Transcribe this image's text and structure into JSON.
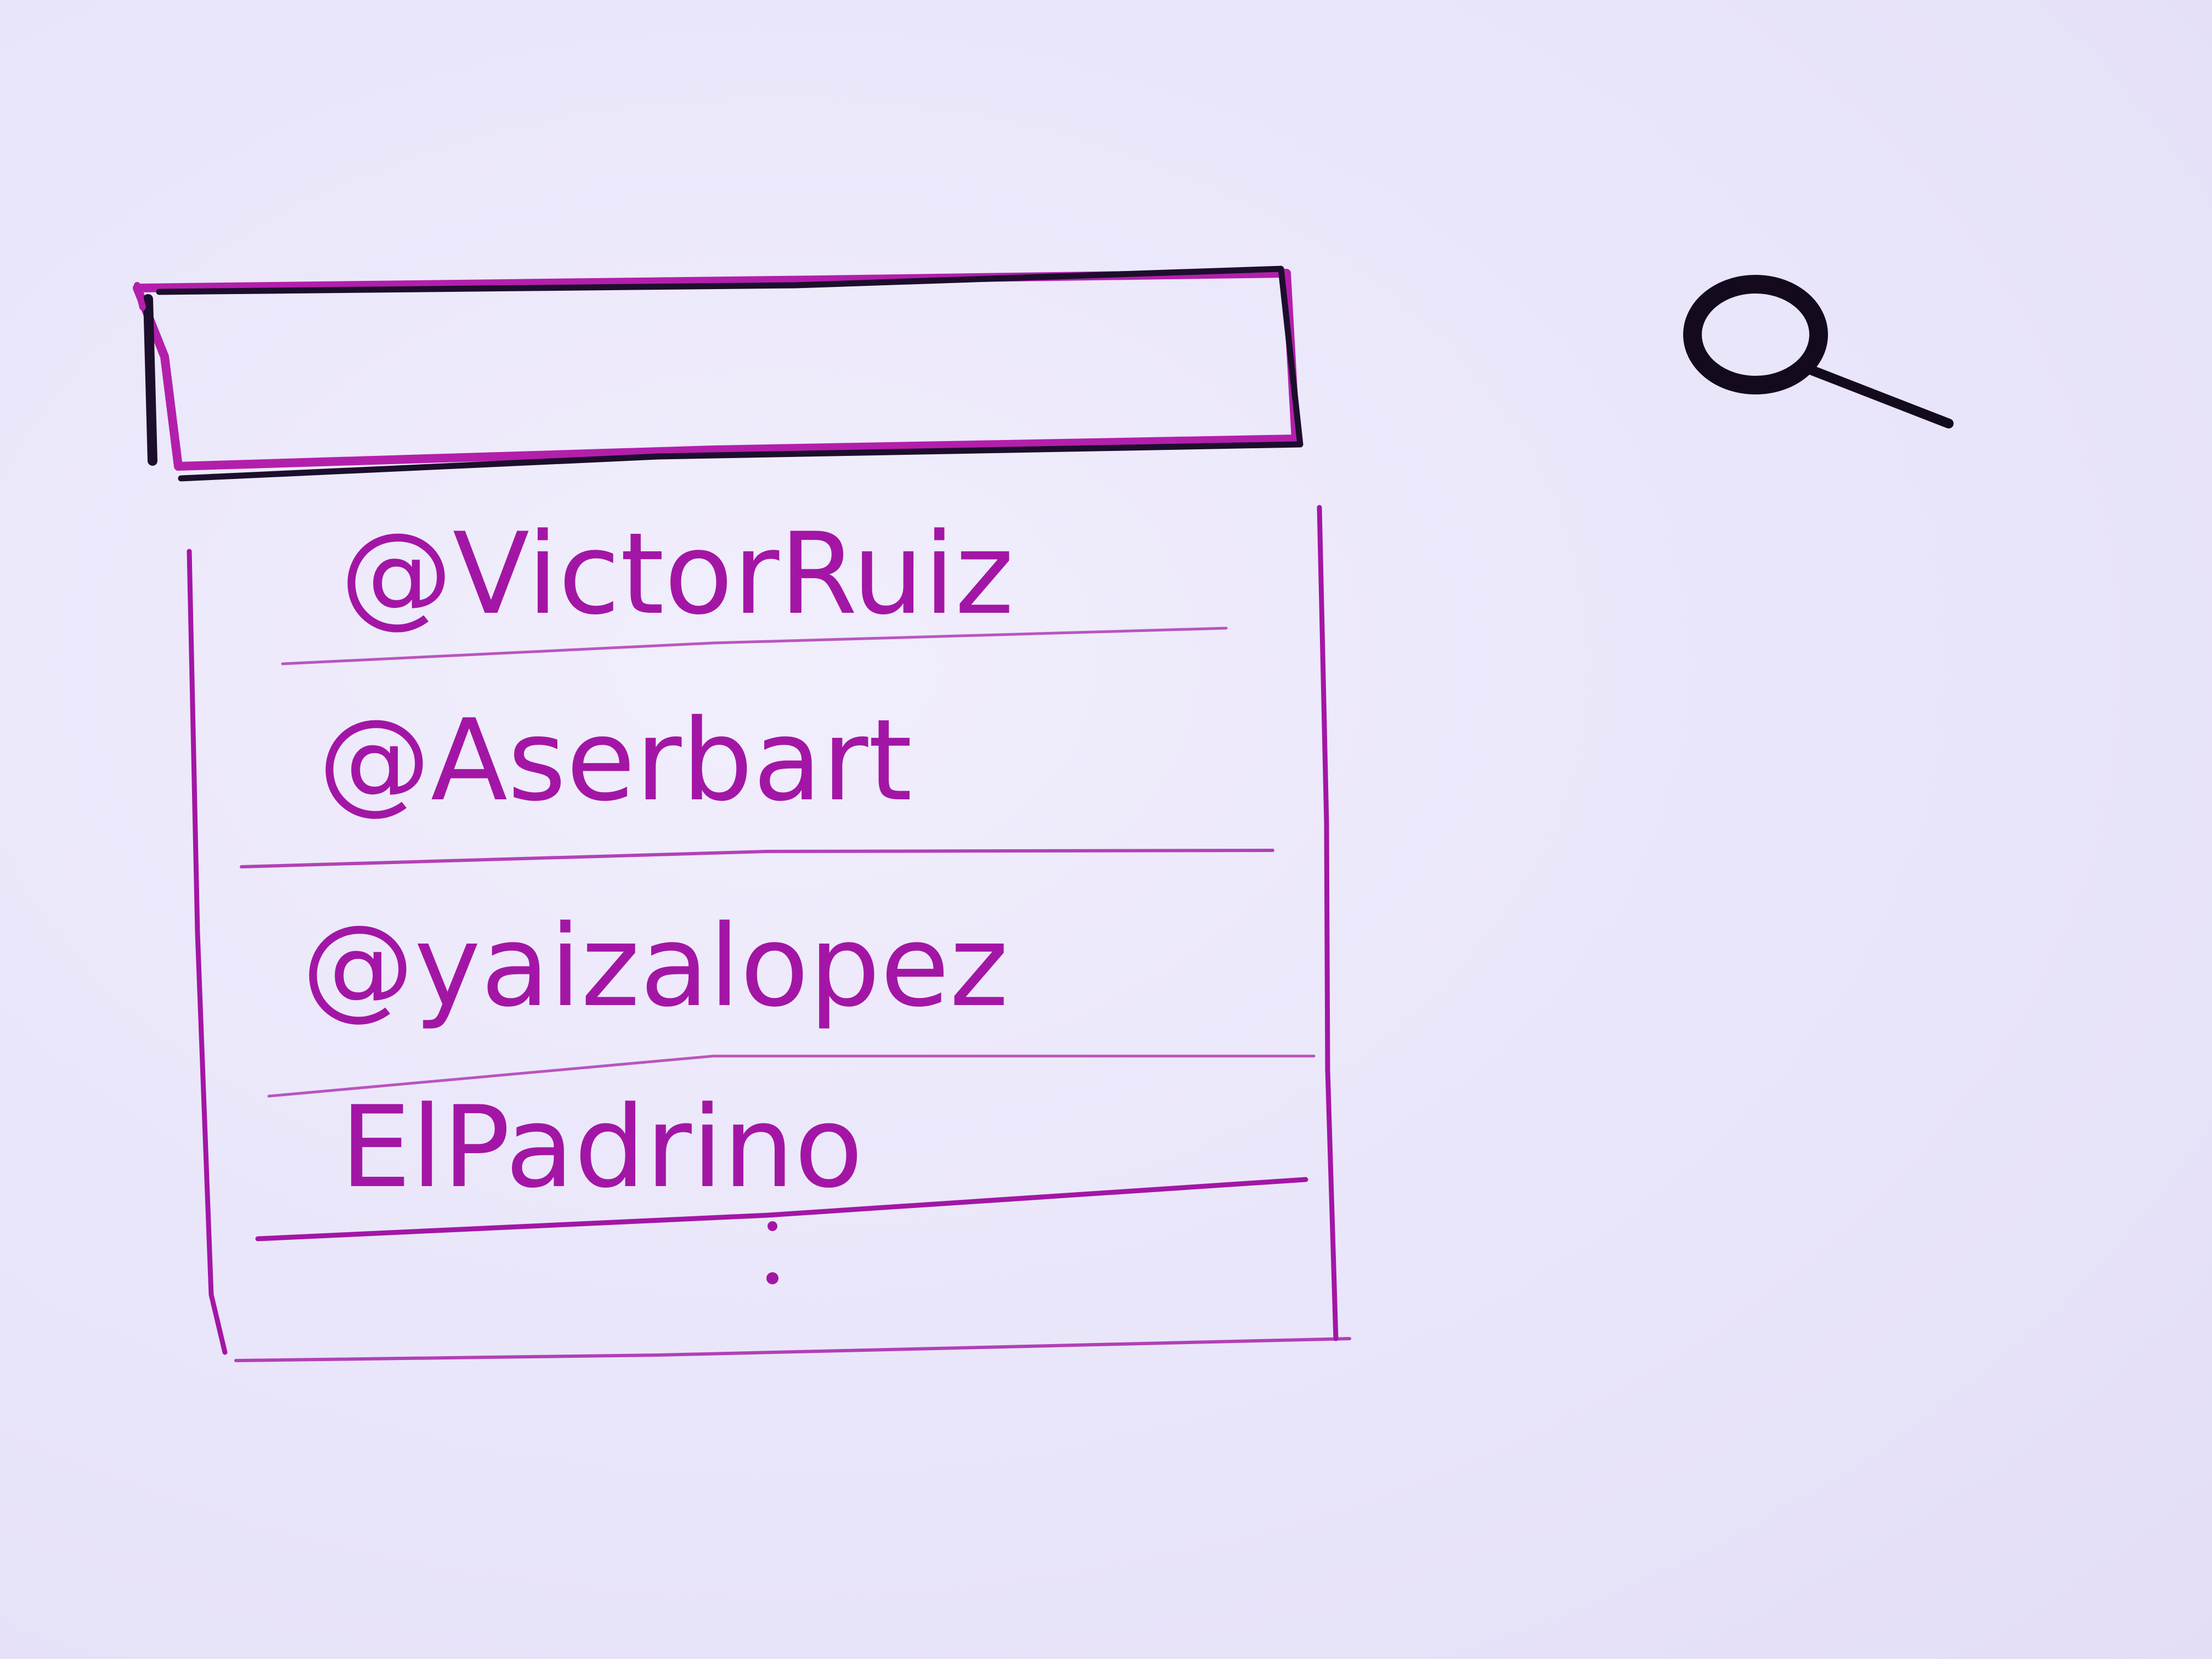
{
  "search": {
    "value": "",
    "placeholder": ""
  },
  "search_button": {
    "icon": "magnifier-icon"
  },
  "suggestions": [
    {
      "label": "@VictorRuiz"
    },
    {
      "label": "@Aserbart"
    },
    {
      "label": "@yaizalopez"
    },
    {
      "label": "ElPadrino"
    }
  ],
  "colors": {
    "paper": "#ebe7fa",
    "ink_magenta": "#a316a5",
    "ink_black": "#140a1e"
  }
}
